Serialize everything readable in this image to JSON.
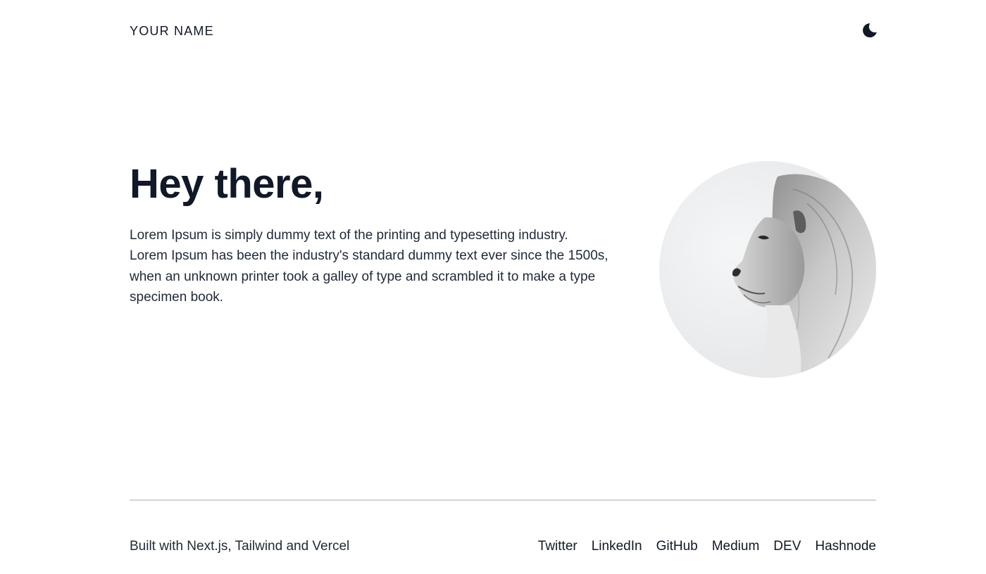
{
  "header": {
    "brand": "YOUR NAME",
    "theme_toggle_icon": "moon-icon"
  },
  "hero": {
    "title": "Hey there,",
    "paragraph": "Lorem Ipsum is simply dummy text of the printing and typesetting industry. Lorem Ipsum has been the industry's standard dummy text ever since the 1500s, when an unknown printer took a galley of type and scrambled it to make a type specimen book.",
    "avatar_icon": "lion-profile-image"
  },
  "footer": {
    "credit": "Built with Next.js, Tailwind and Vercel",
    "links": [
      "Twitter",
      "LinkedIn",
      "GitHub",
      "Medium",
      "DEV",
      "Hashnode"
    ]
  },
  "colors": {
    "text": "#111827",
    "body_text": "#1f2937",
    "divider": "#d1d5db",
    "background": "#ffffff"
  }
}
